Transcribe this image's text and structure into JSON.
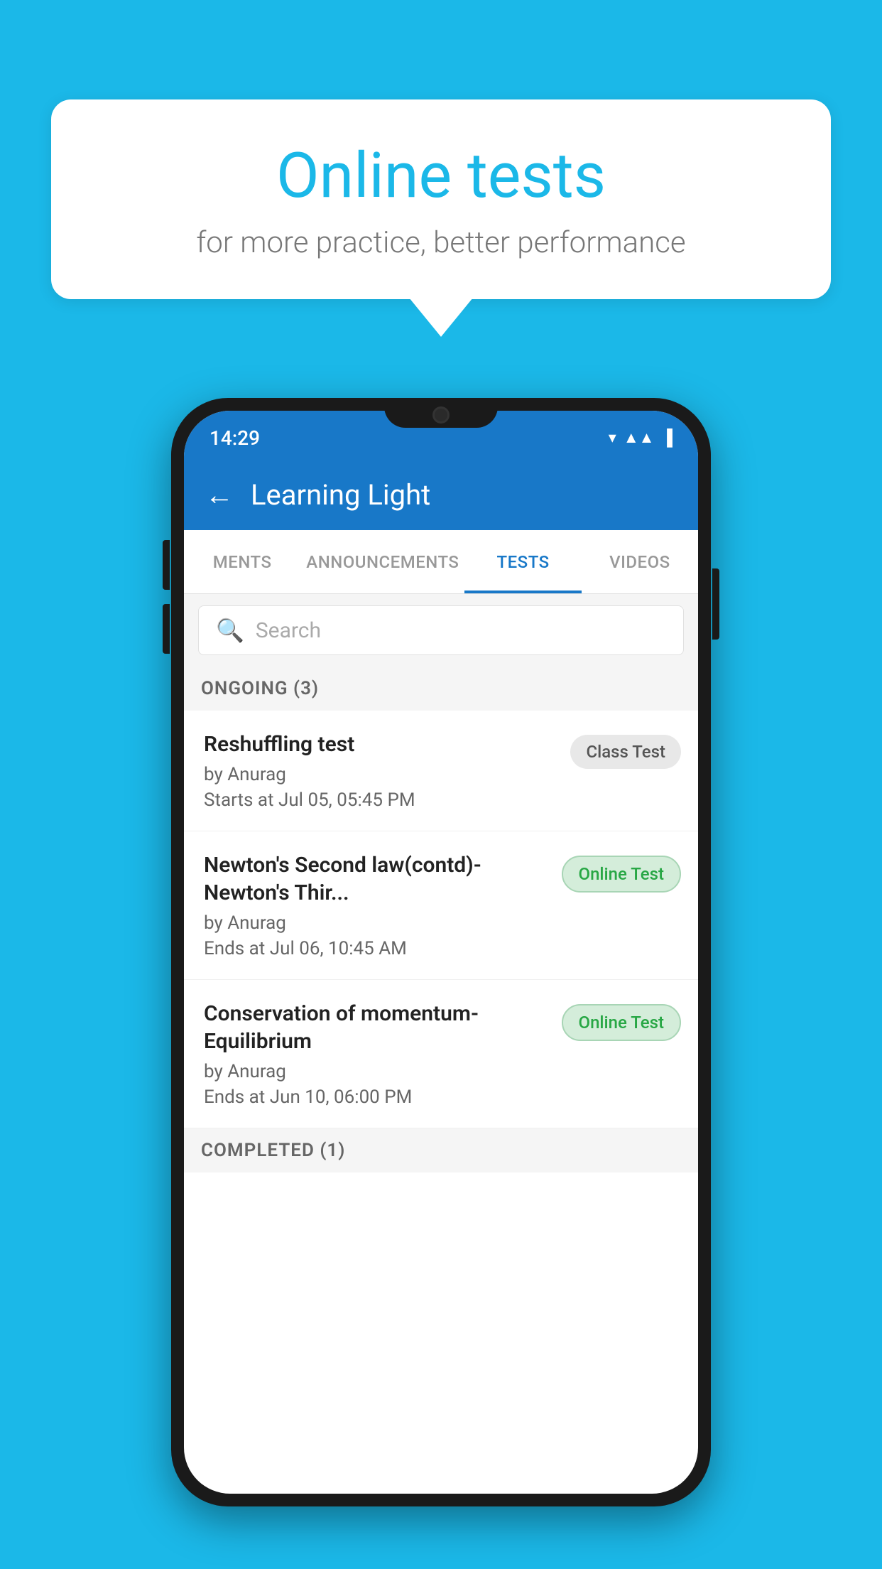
{
  "background_color": "#1BB8E8",
  "hero": {
    "title": "Online tests",
    "subtitle": "for more practice, better performance"
  },
  "status_bar": {
    "time": "14:29",
    "wifi": "▾",
    "signal": "▲▲",
    "battery": "▐"
  },
  "app_header": {
    "back_label": "←",
    "title": "Learning Light"
  },
  "tabs": [
    {
      "label": "MENTS",
      "active": false
    },
    {
      "label": "ANNOUNCEMENTS",
      "active": false
    },
    {
      "label": "TESTS",
      "active": true
    },
    {
      "label": "VIDEOS",
      "active": false
    }
  ],
  "search": {
    "placeholder": "Search"
  },
  "ongoing_section": {
    "label": "ONGOING (3)"
  },
  "tests": [
    {
      "name": "Reshuffling test",
      "author": "by Anurag",
      "date": "Starts at  Jul 05, 05:45 PM",
      "badge": "Class Test",
      "badge_type": "class"
    },
    {
      "name": "Newton's Second law(contd)-Newton's Thir...",
      "author": "by Anurag",
      "date": "Ends at  Jul 06, 10:45 AM",
      "badge": "Online Test",
      "badge_type": "online"
    },
    {
      "name": "Conservation of momentum-Equilibrium",
      "author": "by Anurag",
      "date": "Ends at  Jun 10, 06:00 PM",
      "badge": "Online Test",
      "badge_type": "online"
    }
  ],
  "completed_section": {
    "label": "COMPLETED (1)"
  }
}
